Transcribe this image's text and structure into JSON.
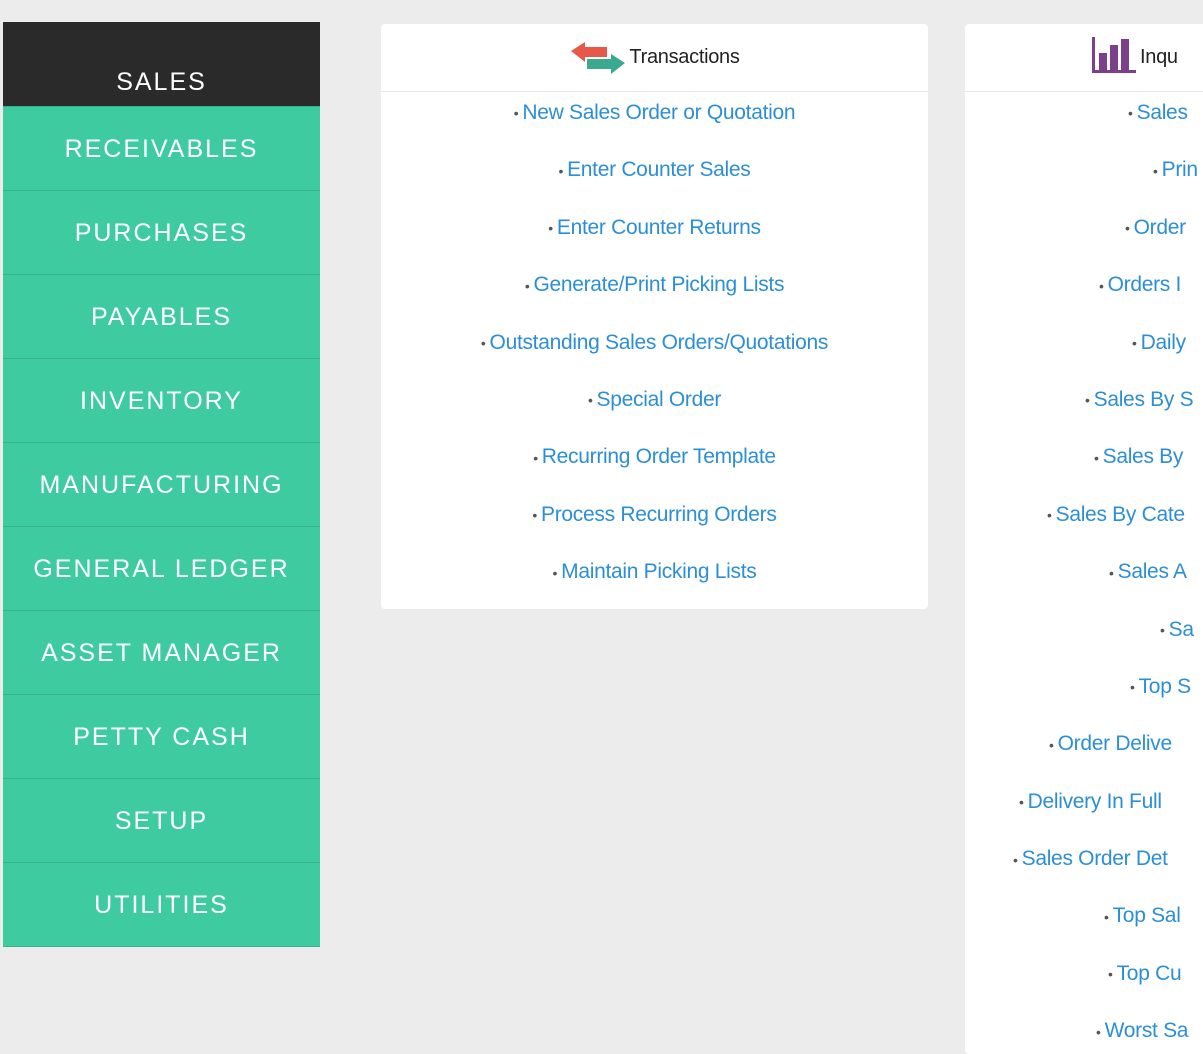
{
  "sidebar": {
    "items": [
      {
        "label": "SALES",
        "active": true
      },
      {
        "label": "RECEIVABLES"
      },
      {
        "label": "PURCHASES"
      },
      {
        "label": "PAYABLES"
      },
      {
        "label": "INVENTORY"
      },
      {
        "label": "MANUFACTURING"
      },
      {
        "label": "GENERAL LEDGER"
      },
      {
        "label": "ASSET MANAGER"
      },
      {
        "label": "PETTY CASH"
      },
      {
        "label": "SETUP"
      },
      {
        "label": "UTILITIES"
      }
    ]
  },
  "transactions": {
    "title": "Transactions",
    "icon": "transfer-arrows-icon",
    "links": [
      "New Sales Order or Quotation",
      "Enter Counter Sales",
      "Enter Counter Returns",
      "Generate/Print Picking Lists",
      "Outstanding Sales Orders/Quotations",
      "Special Order",
      "Recurring Order Template",
      "Process Recurring Orders",
      "Maintain Picking Lists"
    ]
  },
  "inquiries": {
    "title": "Inqu",
    "icon": "bar-chart-icon",
    "links": [
      "Sales",
      "Prin",
      "Order",
      "Orders I",
      "Daily",
      "Sales By S",
      "Sales By",
      "Sales By Cate",
      "Sales A",
      "Sa",
      "Top S",
      "Order Delive",
      "Delivery In Full",
      "Sales Order Det",
      "Top Sal",
      "Top Cu",
      "Worst Sa"
    ]
  },
  "colors": {
    "sidebar_bg": "#3ecba0",
    "sidebar_active_bg": "#2a2a2a",
    "link": "#2c8fd6",
    "page_bg": "#ececec"
  }
}
